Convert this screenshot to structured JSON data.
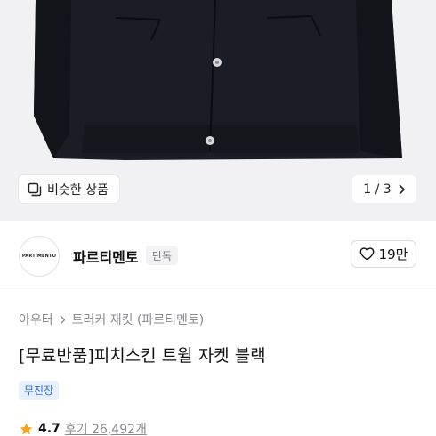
{
  "gallery": {
    "similar_label": "비슷한 상품",
    "pager_text": "1 / 3"
  },
  "brand": {
    "logo_text": "PARTIMENTO",
    "name": "파르티멘토",
    "badge": "단독",
    "like_count": "19만"
  },
  "breadcrumb": {
    "category": "아우터",
    "subcategory": "트러커 재킷 (파르티멘토)"
  },
  "product": {
    "title": "[무료반품]피치스킨 트윌 자켓 블랙",
    "tag": "무진장"
  },
  "rating": {
    "score": "4.7",
    "reviews": "후기 26,492개"
  },
  "colors": {
    "star": "#f2a51e",
    "tag_bg": "#e6f0ff",
    "tag_text": "#2f6de1",
    "jacket": "#1a1d24"
  }
}
